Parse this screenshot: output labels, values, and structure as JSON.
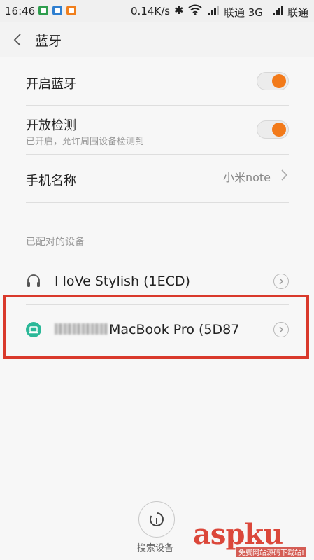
{
  "status_bar": {
    "time": "16:46",
    "speed": "0.14K/s",
    "carrier1": "联通 3G",
    "carrier2": "联通"
  },
  "header": {
    "title": "蓝牙"
  },
  "settings": {
    "bluetooth_toggle": {
      "label": "开启蓝牙",
      "on": true
    },
    "discoverable": {
      "label": "开放检测",
      "subtitle": "已开启，允许周围设备检测到",
      "on": true
    },
    "phone_name": {
      "label": "手机名称",
      "value": "小米note"
    }
  },
  "paired": {
    "section_label": "已配对的设备",
    "devices": [
      {
        "name": "I loVe Stylish (1ECD)",
        "icon": "headset-icon"
      },
      {
        "name": "MacBook Pro (5D87",
        "icon": "laptop-icon"
      }
    ]
  },
  "footer": {
    "search_label": "搜索设备"
  },
  "watermark": {
    "brand": "aspku",
    "sub": "免费网站源码下载站!"
  },
  "colors": {
    "accent": "#f27a1a",
    "highlight": "#d9392b",
    "device_icon": "#2bb898"
  }
}
